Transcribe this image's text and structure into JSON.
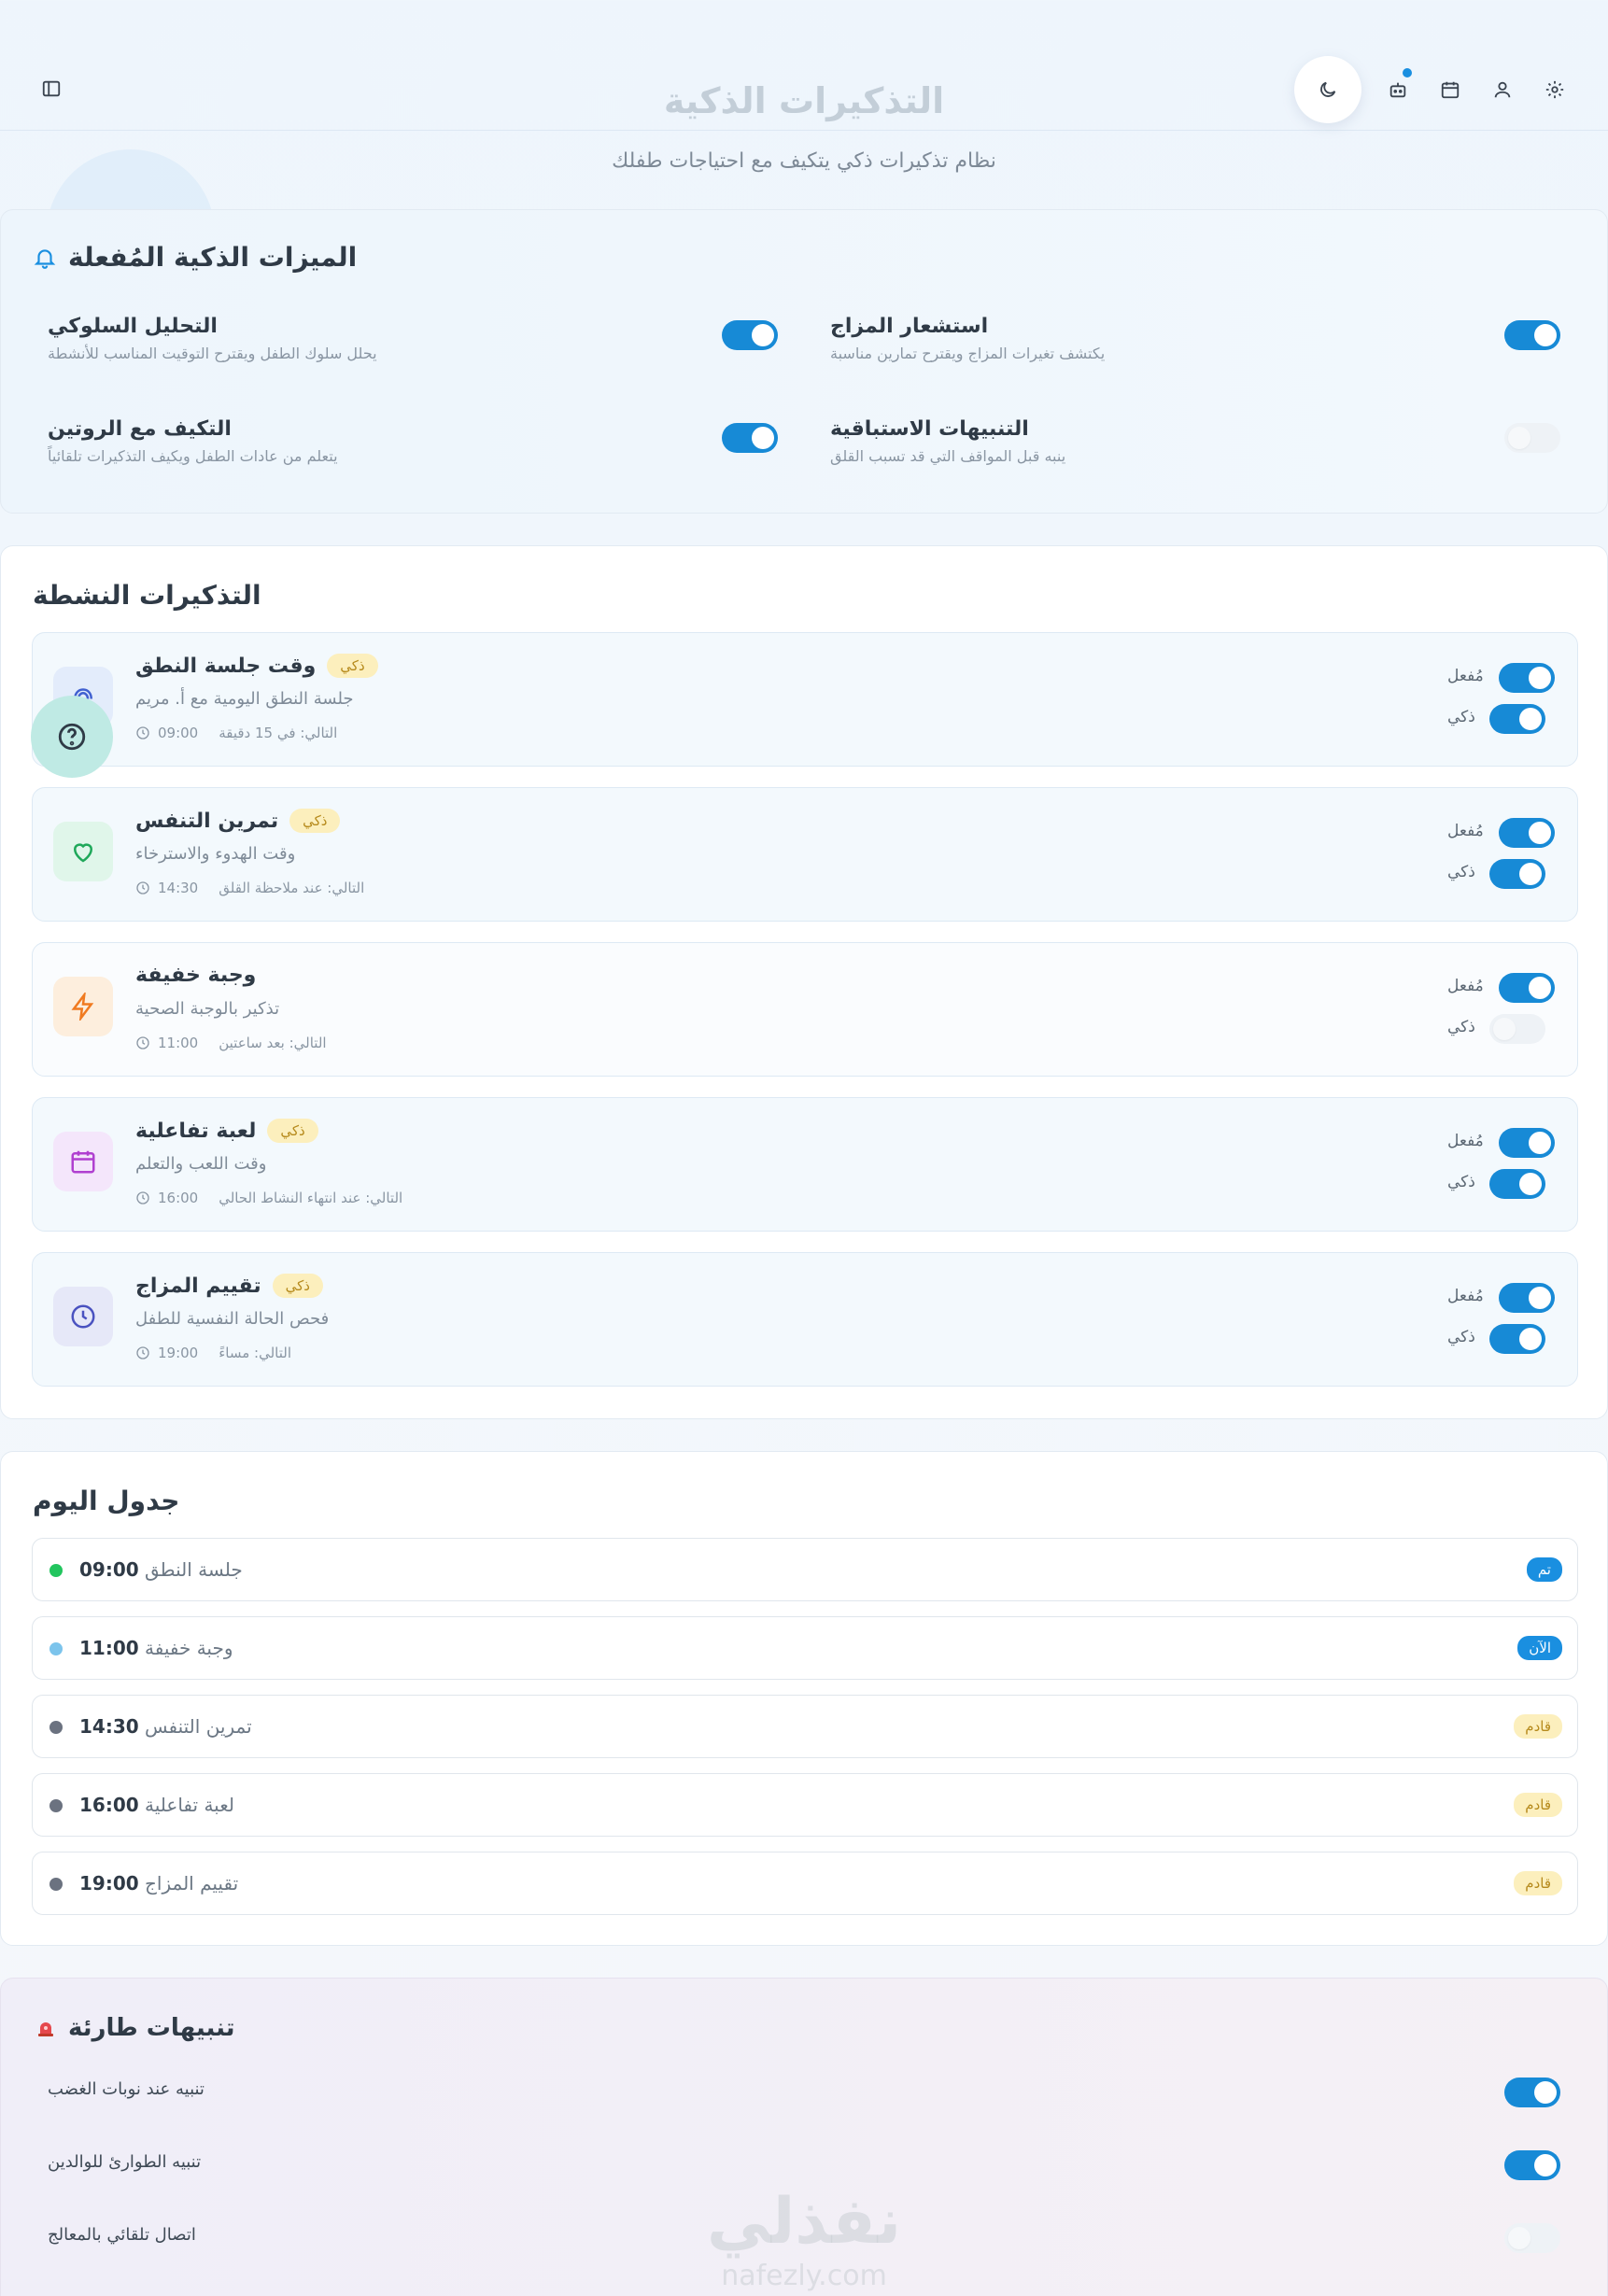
{
  "header": {
    "title": "التذكيرات الذكية",
    "subtitle": "نظام تذكيرات ذكي يتكيف مع احتياجات طفلك",
    "icons": [
      "moon-icon",
      "robot-icon",
      "calendar-icon",
      "user-icon",
      "gear-icon"
    ]
  },
  "features": {
    "title": "الميزات الذكية المُفعلة",
    "items": [
      {
        "name": "استشعار المزاج",
        "desc": "يكتشف تغيرات المزاج ويقترح تمارين مناسبة",
        "enabled": true
      },
      {
        "name": "التحليل السلوكي",
        "desc": "يحلل سلوك الطفل ويقترح التوقيت المناسب للأنشطة",
        "enabled": true
      },
      {
        "name": "التنبيهات الاستباقية",
        "desc": "ينبه قبل المواقف التي قد تسبب القلق",
        "enabled": false
      },
      {
        "name": "التكيف مع الروتين",
        "desc": "يتعلم من عادات الطفل ويكيف التذكيرات تلقائياً",
        "enabled": true
      }
    ]
  },
  "reminders": {
    "title": "التذكيرات النشطة",
    "enabled_label": "مُفعل",
    "smart_label": "ذكي",
    "items": [
      {
        "title": "وقت جلسة النطق",
        "badge": "ذكي",
        "desc": "جلسة النطق اليومية مع أ. مريم",
        "time": "09:00",
        "next": "التالي: في 15 دقيقة",
        "icon": "speech-icon",
        "smart": true
      },
      {
        "title": "تمرين التنفس",
        "badge": "ذكي",
        "desc": "وقت الهدوء والاسترخاء",
        "time": "14:30",
        "next": "التالي: عند ملاحظة القلق",
        "icon": "heart-icon",
        "smart": true
      },
      {
        "title": "وجبة خفيفة",
        "badge": "",
        "desc": "تذكير بالوجبة الصحية",
        "time": "11:00",
        "next": "التالي: بعد ساعتين",
        "icon": "lightning-icon",
        "smart": false
      },
      {
        "title": "لعبة تفاعلية",
        "badge": "ذكي",
        "desc": "وقت اللعب والتعلم",
        "time": "16:00",
        "next": "التالي: عند انتهاء النشاط الحالي",
        "icon": "calendar-icon",
        "smart": true
      },
      {
        "title": "تقييم المزاج",
        "badge": "ذكي",
        "desc": "فحص الحالة النفسية للطفل",
        "time": "19:00",
        "next": "التالي: مساءً",
        "icon": "clock-icon",
        "smart": true
      }
    ]
  },
  "schedule": {
    "title": "جدول اليوم",
    "items": [
      {
        "time": "09:00",
        "name": "جلسة النطق",
        "status": "تم",
        "dot_color": "#22c55e"
      },
      {
        "time": "11:00",
        "name": "وجبة خفيفة",
        "status": "الآن",
        "dot_color": "#7cc4ec"
      },
      {
        "time": "14:30",
        "name": "تمرين التنفس",
        "status": "قادم",
        "dot_color": "#6b7280"
      },
      {
        "time": "16:00",
        "name": "لعبة تفاعلية",
        "status": "قادم",
        "dot_color": "#6b7280"
      },
      {
        "time": "19:00",
        "name": "تقييم المزاج",
        "status": "قادم",
        "dot_color": "#6b7280"
      }
    ]
  },
  "alerts": {
    "title": "تنبيهات طارئة",
    "items": [
      {
        "label": "تنبيه عند نوبات الغضب",
        "enabled": true
      },
      {
        "label": "تنبيه الطوارئ للوالدين",
        "enabled": true
      },
      {
        "label": "اتصال تلقائي بالمعالج",
        "enabled": false
      }
    ]
  },
  "watermark": {
    "logo": "نفذلي",
    "url": "nafezly.com"
  },
  "colors": {
    "accent": "#178ad6",
    "done": "#1a8fe0",
    "now": "#1a8fe0",
    "upcoming_bg": "#fcefbd"
  }
}
